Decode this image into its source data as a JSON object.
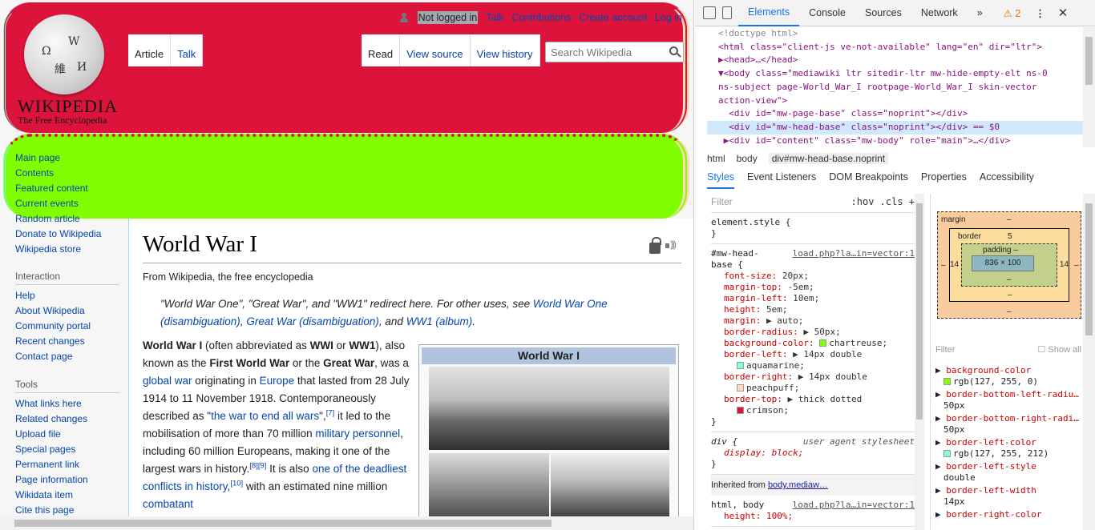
{
  "wiki": {
    "logo": {
      "wordmark": "WIKIPEDIA",
      "tagline": "The Free Encyclopedia"
    },
    "personal_tools": {
      "anon": "Not logged in",
      "talk": "Talk",
      "contributions": "Contributions",
      "create_account": "Create account",
      "login": "Log in"
    },
    "tabs_left": [
      "Article",
      "Talk"
    ],
    "tabs_right": [
      "Read",
      "View source",
      "View history"
    ],
    "search": {
      "placeholder": "Search Wikipedia"
    },
    "nav": {
      "main": [
        "Main page",
        "Contents",
        "Featured content",
        "Current events",
        "Random article",
        "Donate to Wikipedia",
        "Wikipedia store"
      ],
      "interaction_heading": "Interaction",
      "interaction": [
        "Help",
        "About Wikipedia",
        "Community portal",
        "Recent changes",
        "Contact page"
      ],
      "tools_heading": "Tools",
      "tools": [
        "What links here",
        "Related changes",
        "Upload file",
        "Special pages",
        "Permanent link",
        "Page information",
        "Wikidata item",
        "Cite this page"
      ]
    },
    "article": {
      "title": "World War I",
      "sitesub": "From Wikipedia, the free encyclopedia",
      "hatnote": {
        "text": "\"World War One\", \"Great War\", and \"WW1\" redirect here. For other uses, see ",
        "link1": "World War One (disambiguation)",
        "sep1": ", ",
        "link2": "Great War (disambiguation)",
        "sep2": ", and ",
        "link3": "WW1 (album)",
        "end": "."
      },
      "infobox_title": "World War I",
      "lead": {
        "b1": "World War I",
        "t1": " (often abbreviated as ",
        "b2": "WWI",
        "t2": " or ",
        "b3": "WW1",
        "t3": "), also known as the ",
        "b4": "First World War",
        "t4": " or the ",
        "b5": "Great War",
        "t5": ", was a ",
        "l1": "global war",
        "t6": " originating in ",
        "l2": "Europe",
        "t7": " that lasted from 28 July 1914 to 11 November 1918. Contemporaneously described as \"",
        "l3": "the war to end all wars",
        "t8": "\",",
        "s1": "[7]",
        "t9": " it led to the mobilisation of more than 70 million ",
        "l4": "military personnel",
        "t10": ", including 60 million Europeans, making it one of the largest wars in history.",
        "s2": "[8][9]",
        "t11": " It is also ",
        "l5": "one of the deadliest conflicts in history",
        "t12": ",",
        "s3": "[10]",
        "t13": " with an estimated nine million ",
        "l6": "combatant"
      }
    }
  },
  "devtools": {
    "tabs": [
      "Elements",
      "Console",
      "Sources",
      "Network",
      "»"
    ],
    "warnings": "⚠ 2",
    "dom": [
      "<!doctype html>",
      "<html class=\"client-js ve-not-available\" lang=\"en\" dir=\"ltr\">",
      "▶<head>…</head>",
      "▼<body class=\"mediawiki ltr sitedir-ltr mw-hide-empty-elt ns-0",
      "ns-subject page-World_War_I rootpage-World_War_I skin-vector",
      "action-view\">",
      "  <div id=\"mw-page-base\" class=\"noprint\"></div>",
      "  <div id=\"mw-head-base\" class=\"noprint\"></div> == $0",
      " ▶<div id=\"content\" class=\"mw-body\" role=\"main\">…</div>"
    ],
    "breadcrumbs": [
      "html",
      "body",
      "div#mw-head-base.noprint"
    ],
    "subtabs": [
      "Styles",
      "Event Listeners",
      "DOM Breakpoints",
      "Properties",
      "Accessibility"
    ],
    "filter_placeholder": "Filter",
    "filter_tools": ":hov  .cls  +",
    "element_style": "element.style {",
    "close_brace": "}",
    "rule_selector": "#mw-head-",
    "rule_selector2": "base {",
    "rule_source": "load.php?la…in=vector:1",
    "rule_props": [
      {
        "name": "font-size",
        "value": "20px;"
      },
      {
        "name": "margin-top",
        "value": "-5em;"
      },
      {
        "name": "margin-left",
        "value": "10em;"
      },
      {
        "name": "height",
        "value": "5em;"
      },
      {
        "name": "margin",
        "value": "▶ auto;"
      },
      {
        "name": "border-radius",
        "value": "▶ 50px;"
      },
      {
        "name": "background-color",
        "value": "chartreuse;",
        "swatch": "#7fff00"
      },
      {
        "name": "border-left",
        "value": "▶ 14px double",
        "extra": "aquamarine;",
        "swatch": "#7fffd4"
      },
      {
        "name": "border-right",
        "value": "▶ 14px double",
        "extra": "peachpuff;",
        "swatch": "#ffdab9"
      },
      {
        "name": "border-top",
        "value": "▶ thick dotted",
        "extra": "crimson;",
        "swatch": "#dc143c"
      }
    ],
    "ua_selector": "div {",
    "ua_label": "user agent stylesheet",
    "ua_prop": "display: block;",
    "inherited_label": "Inherited from",
    "inherited_from": "body.mediaw…",
    "html_body_selector": "html, body",
    "html_body_source": "load.php?la…in=vector:1",
    "html_body_prop": "height: 100%;",
    "boxmodel": {
      "margin": "margin",
      "margin_dash": "–",
      "border": "border",
      "border_val": "5",
      "padding": "padding –",
      "content": "836 × 100",
      "side": "14",
      "dash": "–"
    },
    "computed_filter": "Filter",
    "show_all": "Show all",
    "computed": [
      {
        "name": "background-color",
        "value": "rgb(127, 255, 0)",
        "swatch": "#7fff00"
      },
      {
        "name": "border-bottom-left-radiu…",
        "value": "50px"
      },
      {
        "name": "border-bottom-right-radi…",
        "value": "50px"
      },
      {
        "name": "border-left-color",
        "value": "rgb(127, 255, 212)",
        "swatch": "#7fffd4"
      },
      {
        "name": "border-left-style",
        "value": "double"
      },
      {
        "name": "border-left-width",
        "value": "14px"
      },
      {
        "name": "border-right-color",
        "value": ""
      }
    ]
  }
}
